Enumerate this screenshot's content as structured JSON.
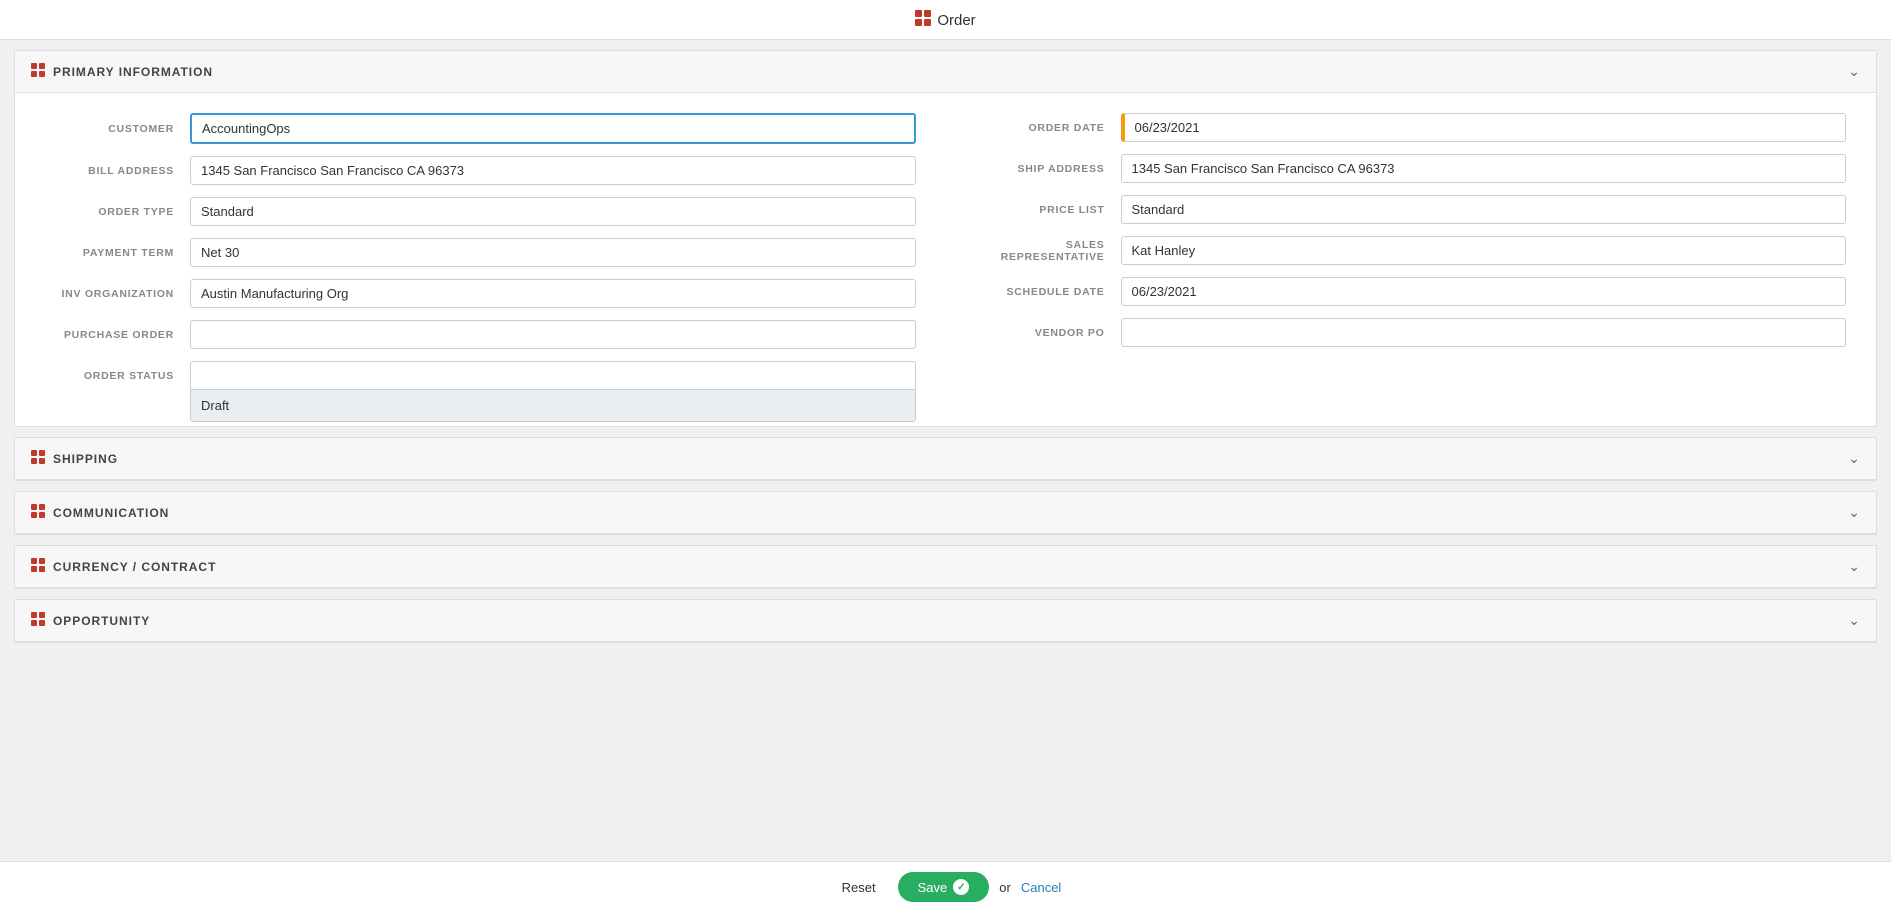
{
  "page": {
    "title": "Order",
    "title_icon": "grid-icon"
  },
  "sections": [
    {
      "id": "primary-information",
      "title": "PRIMARY INFORMATION",
      "expanded": true
    },
    {
      "id": "shipping",
      "title": "SHIPPING",
      "expanded": false
    },
    {
      "id": "communication",
      "title": "COMMUNICATION",
      "expanded": false
    },
    {
      "id": "currency-contract",
      "title": "CURRENCY / CONTRACT",
      "expanded": false
    },
    {
      "id": "opportunity",
      "title": "OPPORTUNITY",
      "expanded": false
    }
  ],
  "form": {
    "left": {
      "customer": {
        "label": "CUSTOMER",
        "value": "AccountingOps",
        "options": [
          "AccountingOps"
        ]
      },
      "bill_address": {
        "label": "BILL ADDRESS",
        "value": "1345 San Francisco San Francisco CA 96373",
        "options": [
          "1345 San Francisco San Francisco CA 96373"
        ]
      },
      "order_type": {
        "label": "ORDER TYPE",
        "value": "Standard",
        "options": [
          "Standard"
        ]
      },
      "payment_term": {
        "label": "PAYMENT TERM",
        "value": "Net 30",
        "options": [
          "Net 30"
        ]
      },
      "inv_organization": {
        "label": "INV ORGANIZATION",
        "value": "Austin Manufacturing Org",
        "options": [
          "Austin Manufacturing Org"
        ]
      },
      "purchase_order": {
        "label": "PURCHASE ORDER",
        "value": "",
        "placeholder": ""
      },
      "order_status": {
        "label": "ORDER STATUS",
        "value": "",
        "dropdown_open": true,
        "dropdown_item": "Draft"
      }
    },
    "right": {
      "order_date": {
        "label": "ORDER DATE",
        "value": "06/23/2021"
      },
      "ship_address": {
        "label": "SHIP ADDRESS",
        "value": "1345 San Francisco San Francisco CA 96373",
        "options": [
          "1345 San Francisco San Francisco CA 96373"
        ]
      },
      "price_list": {
        "label": "PRICE LIST",
        "value": "Standard",
        "options": [
          "Standard"
        ]
      },
      "sales_representative": {
        "label": "SALES REPRESENTATIVE",
        "value": "Kat Hanley",
        "options": [
          "Kat Hanley"
        ]
      },
      "schedule_date": {
        "label": "SCHEDULE DATE",
        "value": "06/23/2021"
      },
      "vendor_po": {
        "label": "VENDOR PO",
        "value": ""
      }
    }
  },
  "footer": {
    "reset_label": "Reset",
    "save_label": "Save",
    "or_text": "or",
    "cancel_label": "Cancel"
  }
}
